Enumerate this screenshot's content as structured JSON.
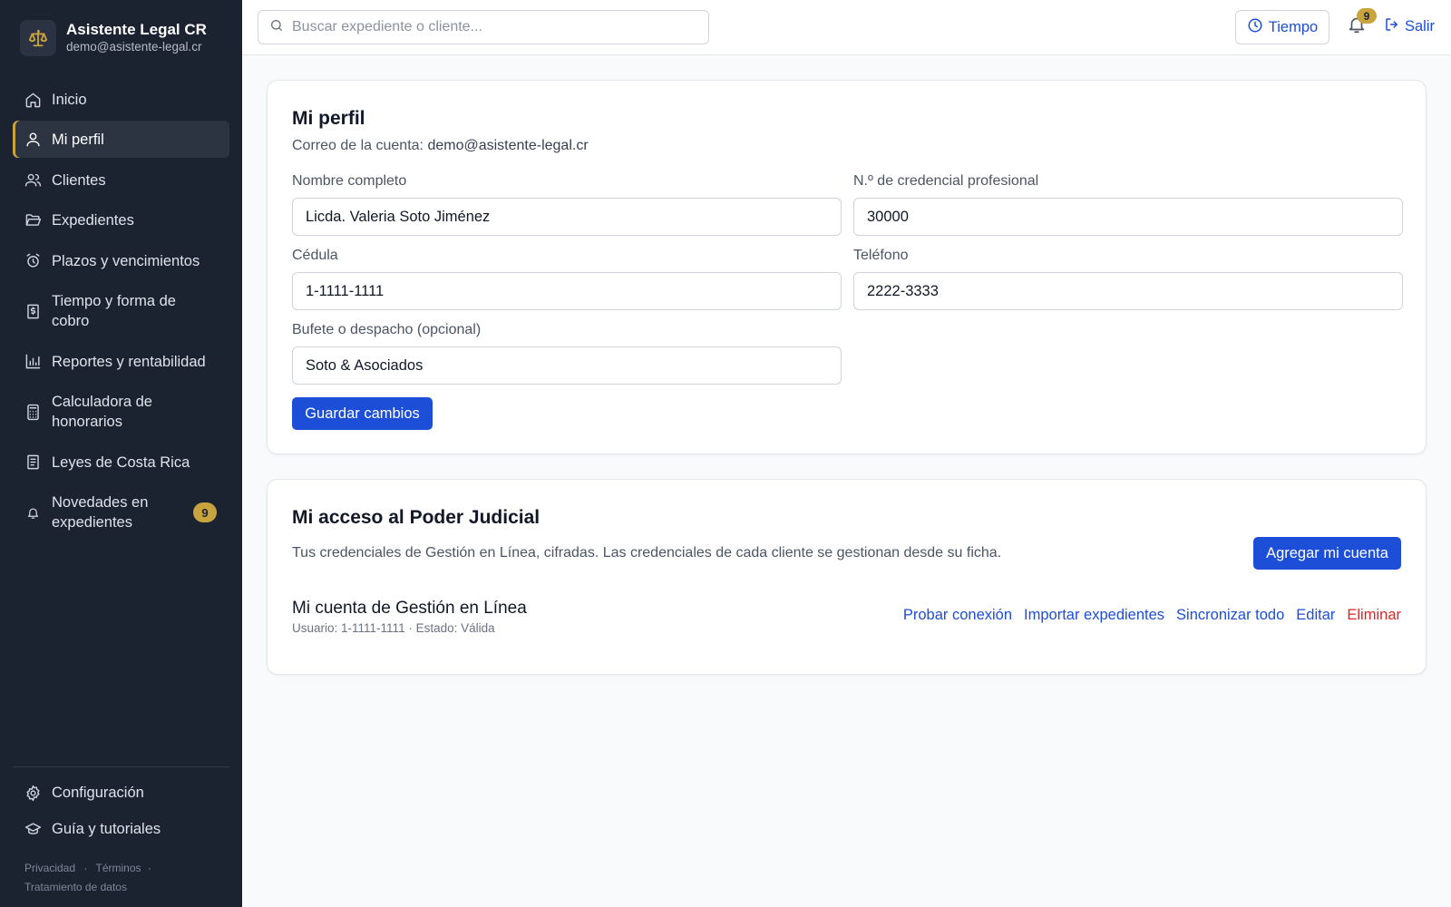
{
  "brand": {
    "name": "Asistente Legal CR",
    "email": "demo@asistente-legal.cr",
    "accent": "#c9a33d"
  },
  "sidebar": {
    "items": [
      {
        "label": "Inicio",
        "icon": "home-icon"
      },
      {
        "label": "Mi perfil",
        "icon": "user-icon",
        "active": true
      },
      {
        "label": "Clientes",
        "icon": "users-icon"
      },
      {
        "label": "Expedientes",
        "icon": "folder-icon"
      },
      {
        "label": "Plazos y vencimientos",
        "icon": "alarm-clock-icon"
      },
      {
        "label": "Tiempo y forma de cobro",
        "icon": "receipt-icon"
      },
      {
        "label": "Reportes y rentabilidad",
        "icon": "bar-chart-icon"
      },
      {
        "label": "Calculadora de honorarios",
        "icon": "calculator-icon"
      },
      {
        "label": "Leyes de Costa Rica",
        "icon": "book-icon"
      },
      {
        "label": "Novedades en expedientes",
        "icon": "bell-icon",
        "badge": "9"
      }
    ],
    "bottom_items": [
      {
        "label": "Configuración",
        "icon": "gear-icon"
      },
      {
        "label": "Guía y tutoriales",
        "icon": "graduation-cap-icon"
      }
    ],
    "footer": {
      "privacy": "Privacidad",
      "terms": "Términos",
      "data": "Tratamiento de datos",
      "separator": "·"
    }
  },
  "topbar": {
    "search_placeholder": "Buscar expediente o cliente...",
    "time_label": "Tiempo",
    "notifications_count": "9",
    "logout_label": "Salir"
  },
  "profile": {
    "title": "Mi perfil",
    "account_email_label": "Correo de la cuenta:",
    "account_email": "demo@asistente-legal.cr",
    "fields": {
      "full_name": {
        "label": "Nombre completo",
        "value": "Licda. Valeria Soto Jiménez"
      },
      "credential": {
        "label": "N.º de credencial profesional",
        "value": "30000"
      },
      "id_number": {
        "label": "Cédula",
        "value": "1-1111-1111"
      },
      "phone": {
        "label": "Teléfono",
        "value": "2222-3333"
      },
      "firm": {
        "label": "Bufete o despacho (opcional)",
        "value": "Soto & Asociados"
      }
    },
    "save_label": "Guardar cambios"
  },
  "judicial": {
    "title": "Mi acceso al Poder Judicial",
    "description": "Tus credenciales de Gestión en Línea, cifradas. Las credenciales de cada cliente se gestionan desde su ficha.",
    "add_label": "Agregar mi cuenta",
    "account": {
      "title": "Mi cuenta de Gestión en Línea",
      "meta": "Usuario: 1-1111-1111 · Estado: Válida",
      "actions": {
        "test": "Probar conexión",
        "import": "Importar expedientes",
        "sync": "Sincronizar todo",
        "edit": "Editar",
        "delete": "Eliminar"
      }
    }
  },
  "colors": {
    "sidebar_bg": "#1b2230",
    "primary": "#1d4ed8",
    "danger": "#dc2626",
    "badge": "#c9a33d"
  }
}
